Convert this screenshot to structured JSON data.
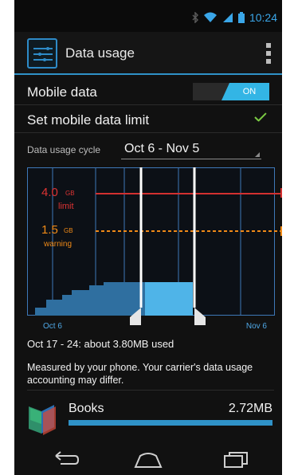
{
  "status_bar": {
    "time": "10:24",
    "icons": [
      "bluetooth-icon",
      "wifi-icon",
      "signal-icon",
      "battery-icon"
    ]
  },
  "action_bar": {
    "title": "Data usage",
    "app_icon": "data-usage-settings-icon",
    "overflow_icon": "overflow-menu-icon"
  },
  "settings": {
    "mobile_data": {
      "label": "Mobile data",
      "toggle_label": "ON",
      "enabled": true
    },
    "set_limit": {
      "label": "Set mobile data limit",
      "checked": true
    },
    "cycle": {
      "label": "Data usage cycle",
      "value": "Oct 6 - Nov 5"
    }
  },
  "chart_text": {
    "limit_value": "4.0",
    "limit_unit": "GB",
    "limit_label": "limit",
    "warning_value": "1.5",
    "warning_unit": "GB",
    "warning_label": "warning",
    "axis_start": "Oct 6",
    "axis_end": "Nov 6"
  },
  "summary": "Oct 17 - 24: about 3.80MB used",
  "notice": "Measured by your phone. Your carrier's data usage accounting may differ.",
  "apps": [
    {
      "name": "Books",
      "size": "2.72MB",
      "icon": "books-app-icon",
      "usage_fraction": 1.0
    }
  ],
  "nav": {
    "back_icon": "back-icon",
    "home_icon": "home-icon",
    "recents_icon": "recent-apps-icon"
  },
  "colors": {
    "accent": "#33b5e5",
    "limit": "#d33030",
    "warning": "#f08a17",
    "usage_fill": "#2f6fa0",
    "selected_fill": "#4fb4e8"
  }
}
